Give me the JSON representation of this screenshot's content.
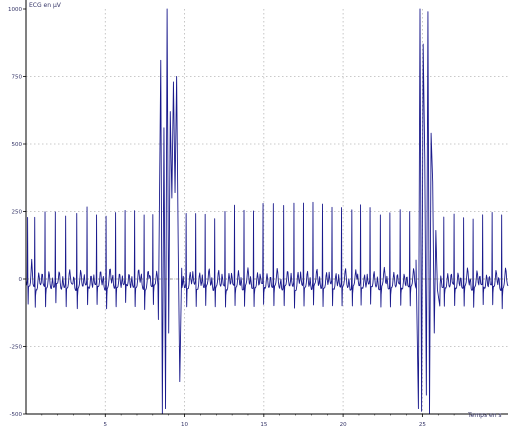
{
  "chart_data": {
    "type": "line",
    "title": "",
    "ylabel": "ECG en µV",
    "xlabel": "Temps en s",
    "xlim": [
      0,
      30.4
    ],
    "ylim": [
      -500,
      1000
    ],
    "grid": true,
    "legend": "none",
    "x_ticks": [
      0,
      5,
      10,
      15,
      20,
      25
    ],
    "y_ticks": [
      -500,
      -250,
      0,
      250,
      500,
      750,
      1000
    ],
    "x_tick_labels": [
      "5",
      "10",
      "15",
      "20",
      "25"
    ],
    "y_tick_labels": [
      "-500",
      "-250",
      "0",
      "250",
      "500",
      "750",
      "1000"
    ],
    "series": [
      {
        "sampling": {
          "start": 0.0,
          "step": 0.04
        },
        "beats_t": [
          0.1,
          0.55,
          1.2,
          1.85,
          2.5,
          3.2,
          3.85,
          4.45,
          5.05,
          5.65,
          6.25,
          6.85,
          7.45,
          8.0,
          10.1,
          10.7,
          11.3,
          11.9,
          12.55,
          13.15,
          13.75,
          14.35,
          14.95,
          15.6,
          16.25,
          16.9,
          17.5,
          18.1,
          18.7,
          19.3,
          19.9,
          20.55,
          21.1,
          21.7,
          22.35,
          22.95,
          23.6,
          24.2,
          26.35,
          27.0,
          27.6,
          28.2,
          28.8,
          29.4,
          30.0
        ],
        "beats_peak": [
          220,
          230,
          250,
          240,
          235,
          255,
          260,
          230,
          245,
          250,
          240,
          255,
          250,
          235,
          245,
          240,
          240,
          230,
          250,
          270,
          260,
          255,
          270,
          280,
          275,
          285,
          280,
          285,
          280,
          260,
          265,
          260,
          270,
          255,
          245,
          250,
          250,
          250,
          230,
          235,
          230,
          230,
          230,
          240,
          250
        ],
        "artifacts": [
          {
            "t": 8.35,
            "y": -150
          },
          {
            "t": 8.5,
            "y": 810
          },
          {
            "t": 8.6,
            "y": -500
          },
          {
            "t": 8.7,
            "y": 560
          },
          {
            "t": 8.8,
            "y": -480
          },
          {
            "t": 8.9,
            "y": 1000
          },
          {
            "t": 9.0,
            "y": -200
          },
          {
            "t": 9.1,
            "y": 620
          },
          {
            "t": 9.2,
            "y": 300
          },
          {
            "t": 9.3,
            "y": 730
          },
          {
            "t": 9.4,
            "y": 320
          },
          {
            "t": 9.5,
            "y": 750
          },
          {
            "t": 9.6,
            "y": 130
          },
          {
            "t": 9.7,
            "y": -380
          },
          {
            "t": 9.82,
            "y": 40
          },
          {
            "t": 24.6,
            "y": 70
          },
          {
            "t": 24.75,
            "y": -480
          },
          {
            "t": 24.85,
            "y": 1000
          },
          {
            "t": 24.95,
            "y": -490
          },
          {
            "t": 25.05,
            "y": 870
          },
          {
            "t": 25.15,
            "y": 450
          },
          {
            "t": 25.25,
            "y": -430
          },
          {
            "t": 25.35,
            "y": 990
          },
          {
            "t": 25.45,
            "y": -500
          },
          {
            "t": 25.55,
            "y": 540
          },
          {
            "t": 25.65,
            "y": 360
          },
          {
            "t": 25.75,
            "y": -200
          },
          {
            "t": 25.85,
            "y": 180
          },
          {
            "t": 25.95,
            "y": -40
          },
          {
            "t": 26.1,
            "y": -100
          }
        ]
      }
    ]
  }
}
